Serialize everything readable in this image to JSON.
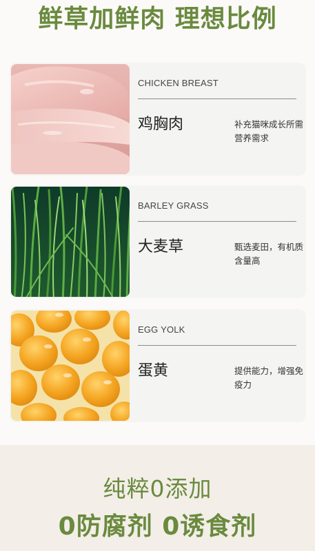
{
  "header": {
    "title": "鲜草加鲜肉 理想比例"
  },
  "cards": [
    {
      "en": "CHICKEN BREAST",
      "cn": "鸡胸肉",
      "desc": "补充猫咪成长所需营养需求",
      "image_icon": "chicken-breast-photo"
    },
    {
      "en": "BARLEY GRASS",
      "cn": "大麦草",
      "desc": "甄选麦田，有机质含量高",
      "image_icon": "barley-grass-photo"
    },
    {
      "en": "EGG YOLK",
      "cn": "蛋黄",
      "desc": "提供能力，增强免疫力",
      "image_icon": "egg-yolk-photo"
    }
  ],
  "footer": {
    "line1": "纯粹0添加",
    "line2": "0防腐剂 0诱食剂"
  },
  "colors": {
    "accent_green": "#6a8a3e",
    "card_bg": "#f4f4f2",
    "footer_bg": "#f3eee8"
  }
}
